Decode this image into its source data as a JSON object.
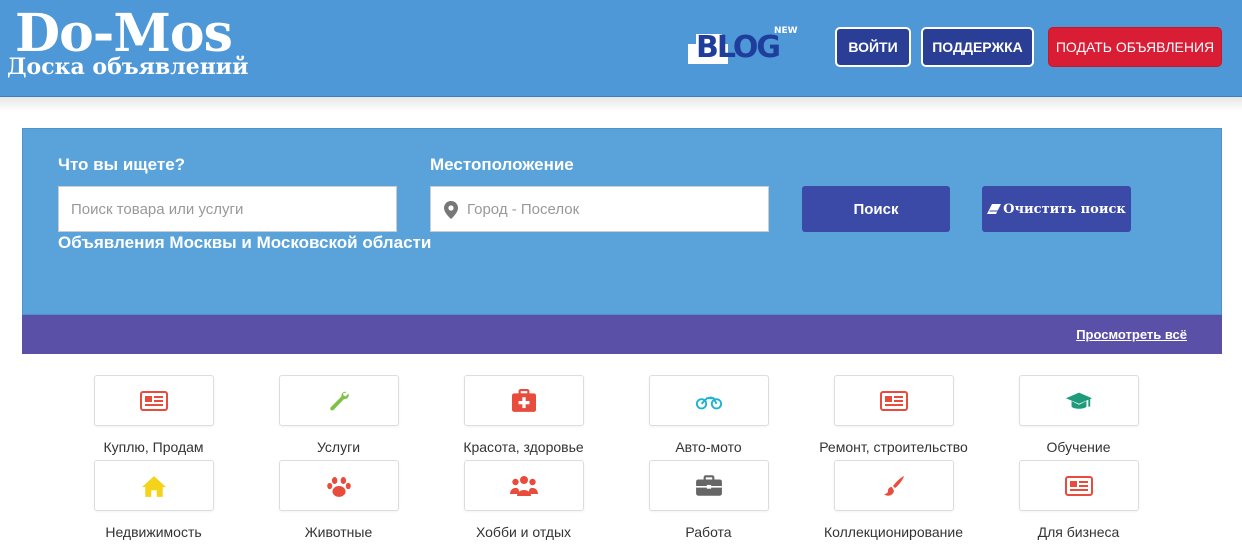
{
  "header": {
    "logo_title": "Do-Mos",
    "logo_subtitle": "Доска объявлений",
    "blog_text": "BLOG",
    "blog_badge": "NEW",
    "login_label": "ВОЙТИ",
    "support_label": "ПОДДЕРЖКА",
    "post_ad_label": "ПОДАТЬ ОБЪЯВЛЕНИЯ",
    "colors": {
      "background": "#4f98d8",
      "nav_button": "#2b3e96",
      "post_button": "#d81d35"
    }
  },
  "search": {
    "what_label": "Что вы ищете?",
    "what_placeholder": "Поиск товара или услуги",
    "location_label": "Местоположение",
    "location_placeholder": "Город - Поселок",
    "region_note": "Объявления Москвы и Московской области",
    "search_button": "Поиск",
    "clear_button": "Очистить поиск",
    "location_icon": "map-pin-icon",
    "clear_icon": "eraser-icon"
  },
  "category_bar": {
    "view_all": "Просмотреть всё",
    "color": "#5b50a8"
  },
  "categories": [
    {
      "label": "Куплю, Продам",
      "icon": "newspaper-icon",
      "color": "#e84c3d"
    },
    {
      "label": "Услуги",
      "icon": "wrench-icon",
      "color": "#7cc243"
    },
    {
      "label": "Красота, здоровье",
      "icon": "medkit-icon",
      "color": "#e84c3d"
    },
    {
      "label": "Авто-мото",
      "icon": "motorcycle-icon",
      "color": "#1ab3d6"
    },
    {
      "label": "Ремонт, строительство",
      "icon": "newspaper-icon",
      "color": "#e84c3d"
    },
    {
      "label": "Обучение",
      "icon": "graduation-cap-icon",
      "color": "#1e9b7b"
    },
    {
      "label": "Недвижимость",
      "icon": "home-icon",
      "color": "#f5d31a"
    },
    {
      "label": "Животные",
      "icon": "paw-icon",
      "color": "#e84c3d"
    },
    {
      "label": "Хобби и отдых",
      "icon": "users-icon",
      "color": "#e84c3d"
    },
    {
      "label": "Работа",
      "icon": "briefcase-icon",
      "color": "#666666"
    },
    {
      "label": "Коллекционирование",
      "icon": "paintbrush-icon",
      "color": "#e84c3d"
    },
    {
      "label": "Для бизнеса",
      "icon": "newspaper-icon",
      "color": "#e84c3d"
    }
  ]
}
